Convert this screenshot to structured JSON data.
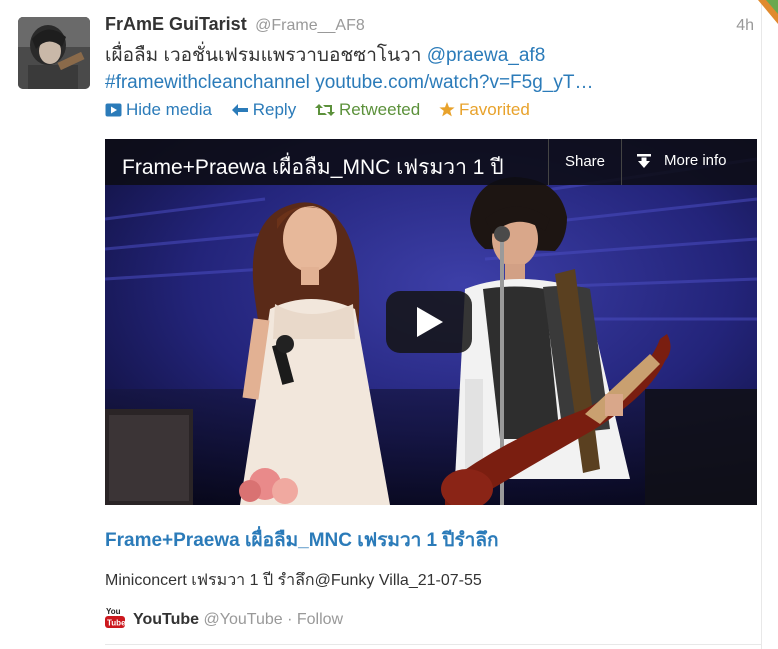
{
  "tweet": {
    "fullname": "FrAmE GuiTarist",
    "username": "@Frame__AF8",
    "time": "4h",
    "text_line1_plain": "เผื่อลืม เวอชั่นเฟรมแพรวาบอชซาโนวา ",
    "text_line1_mention": "@praewa_af8",
    "text_line2_hashtag": "#framewithcleanchannel",
    "text_line2_link": "youtube.com/watch?v=F5g_yT…"
  },
  "actions": {
    "hide_media": "Hide media",
    "reply": "Reply",
    "retweeted": "Retweeted",
    "favorited": "Favorited"
  },
  "video": {
    "title": "Frame+Praewa เผื่อลืม_MNC เฟรมวา 1 ปี",
    "share": "Share",
    "more_info": "More info"
  },
  "card": {
    "title": "Frame+Praewa เผื่อลืม_MNC เฟรมวา 1 ปีรำลึก",
    "description": "Miniconcert เฟรมวา 1 ปี รำลึก@Funky Villa_21-07-55"
  },
  "attribution": {
    "site_name": "YouTube",
    "handle": "@YouTube",
    "separator": "·",
    "follow": "Follow"
  },
  "colors": {
    "link": "#2b7bb9",
    "retweeted": "#5c913b",
    "favorited": "#e8a22b",
    "muted": "#999999"
  },
  "icons": {
    "hide_media": "media-icon",
    "reply": "reply-arrow-icon",
    "retweeted": "retweet-icon",
    "favorited": "star-icon",
    "play": "play-icon",
    "more_info": "download-arrow-icon",
    "attribution": "youtube-logo-icon"
  }
}
